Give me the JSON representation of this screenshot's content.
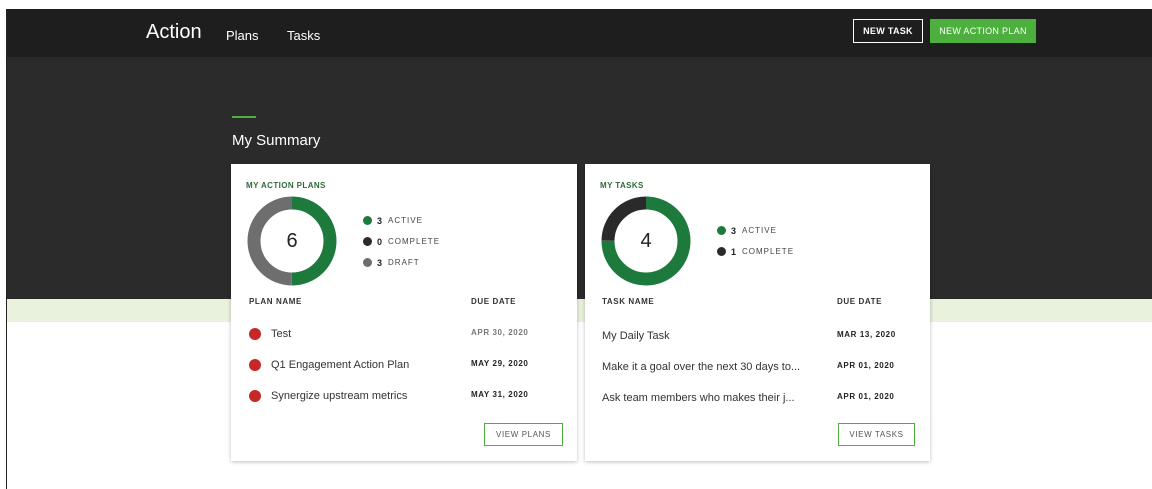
{
  "nav": {
    "brand": "Action",
    "links": [
      "Plans",
      "Tasks"
    ],
    "new_task": "NEW TASK",
    "new_action_plan": "NEW ACTION PLAN"
  },
  "hero": {
    "title": "My Summary"
  },
  "colors": {
    "accent": "#4caf3e",
    "active": "#1e7a3c",
    "complete": "#2a2a2a",
    "draft": "#6e6e6e",
    "overdue": "#c62828"
  },
  "plans": {
    "title": "MY ACTION PLANS",
    "total": "6",
    "legend": [
      {
        "count": "3",
        "label": "ACTIVE",
        "value": 3,
        "color": "#1e7a3c"
      },
      {
        "count": "0",
        "label": "COMPLETE",
        "value": 0,
        "color": "#2a2a2a"
      },
      {
        "count": "3",
        "label": "DRAFT",
        "value": 3,
        "color": "#6e6e6e"
      }
    ],
    "col_name": "PLAN NAME",
    "col_date": "DUE DATE",
    "rows": [
      {
        "name": "Test",
        "date": "APR 30, 2020"
      },
      {
        "name": "Q1 Engagement Action Plan",
        "date": "MAY 29, 2020"
      },
      {
        "name": "Synergize upstream metrics",
        "date": "MAY 31, 2020"
      }
    ],
    "button": "VIEW PLANS"
  },
  "tasks": {
    "title": "MY TASKS",
    "total": "4",
    "legend": [
      {
        "count": "3",
        "label": "ACTIVE",
        "value": 3,
        "color": "#1e7a3c"
      },
      {
        "count": "1",
        "label": "COMPLETE",
        "value": 1,
        "color": "#2a2a2a"
      }
    ],
    "col_name": "TASK NAME",
    "col_date": "DUE DATE",
    "rows": [
      {
        "name": "My Daily Task",
        "date": "MAR 13, 2020"
      },
      {
        "name": "Make it a goal over the next 30 days to...",
        "date": "APR 01, 2020"
      },
      {
        "name": "Ask team members who makes their j...",
        "date": "APR 01, 2020"
      }
    ],
    "button": "VIEW TASKS"
  }
}
